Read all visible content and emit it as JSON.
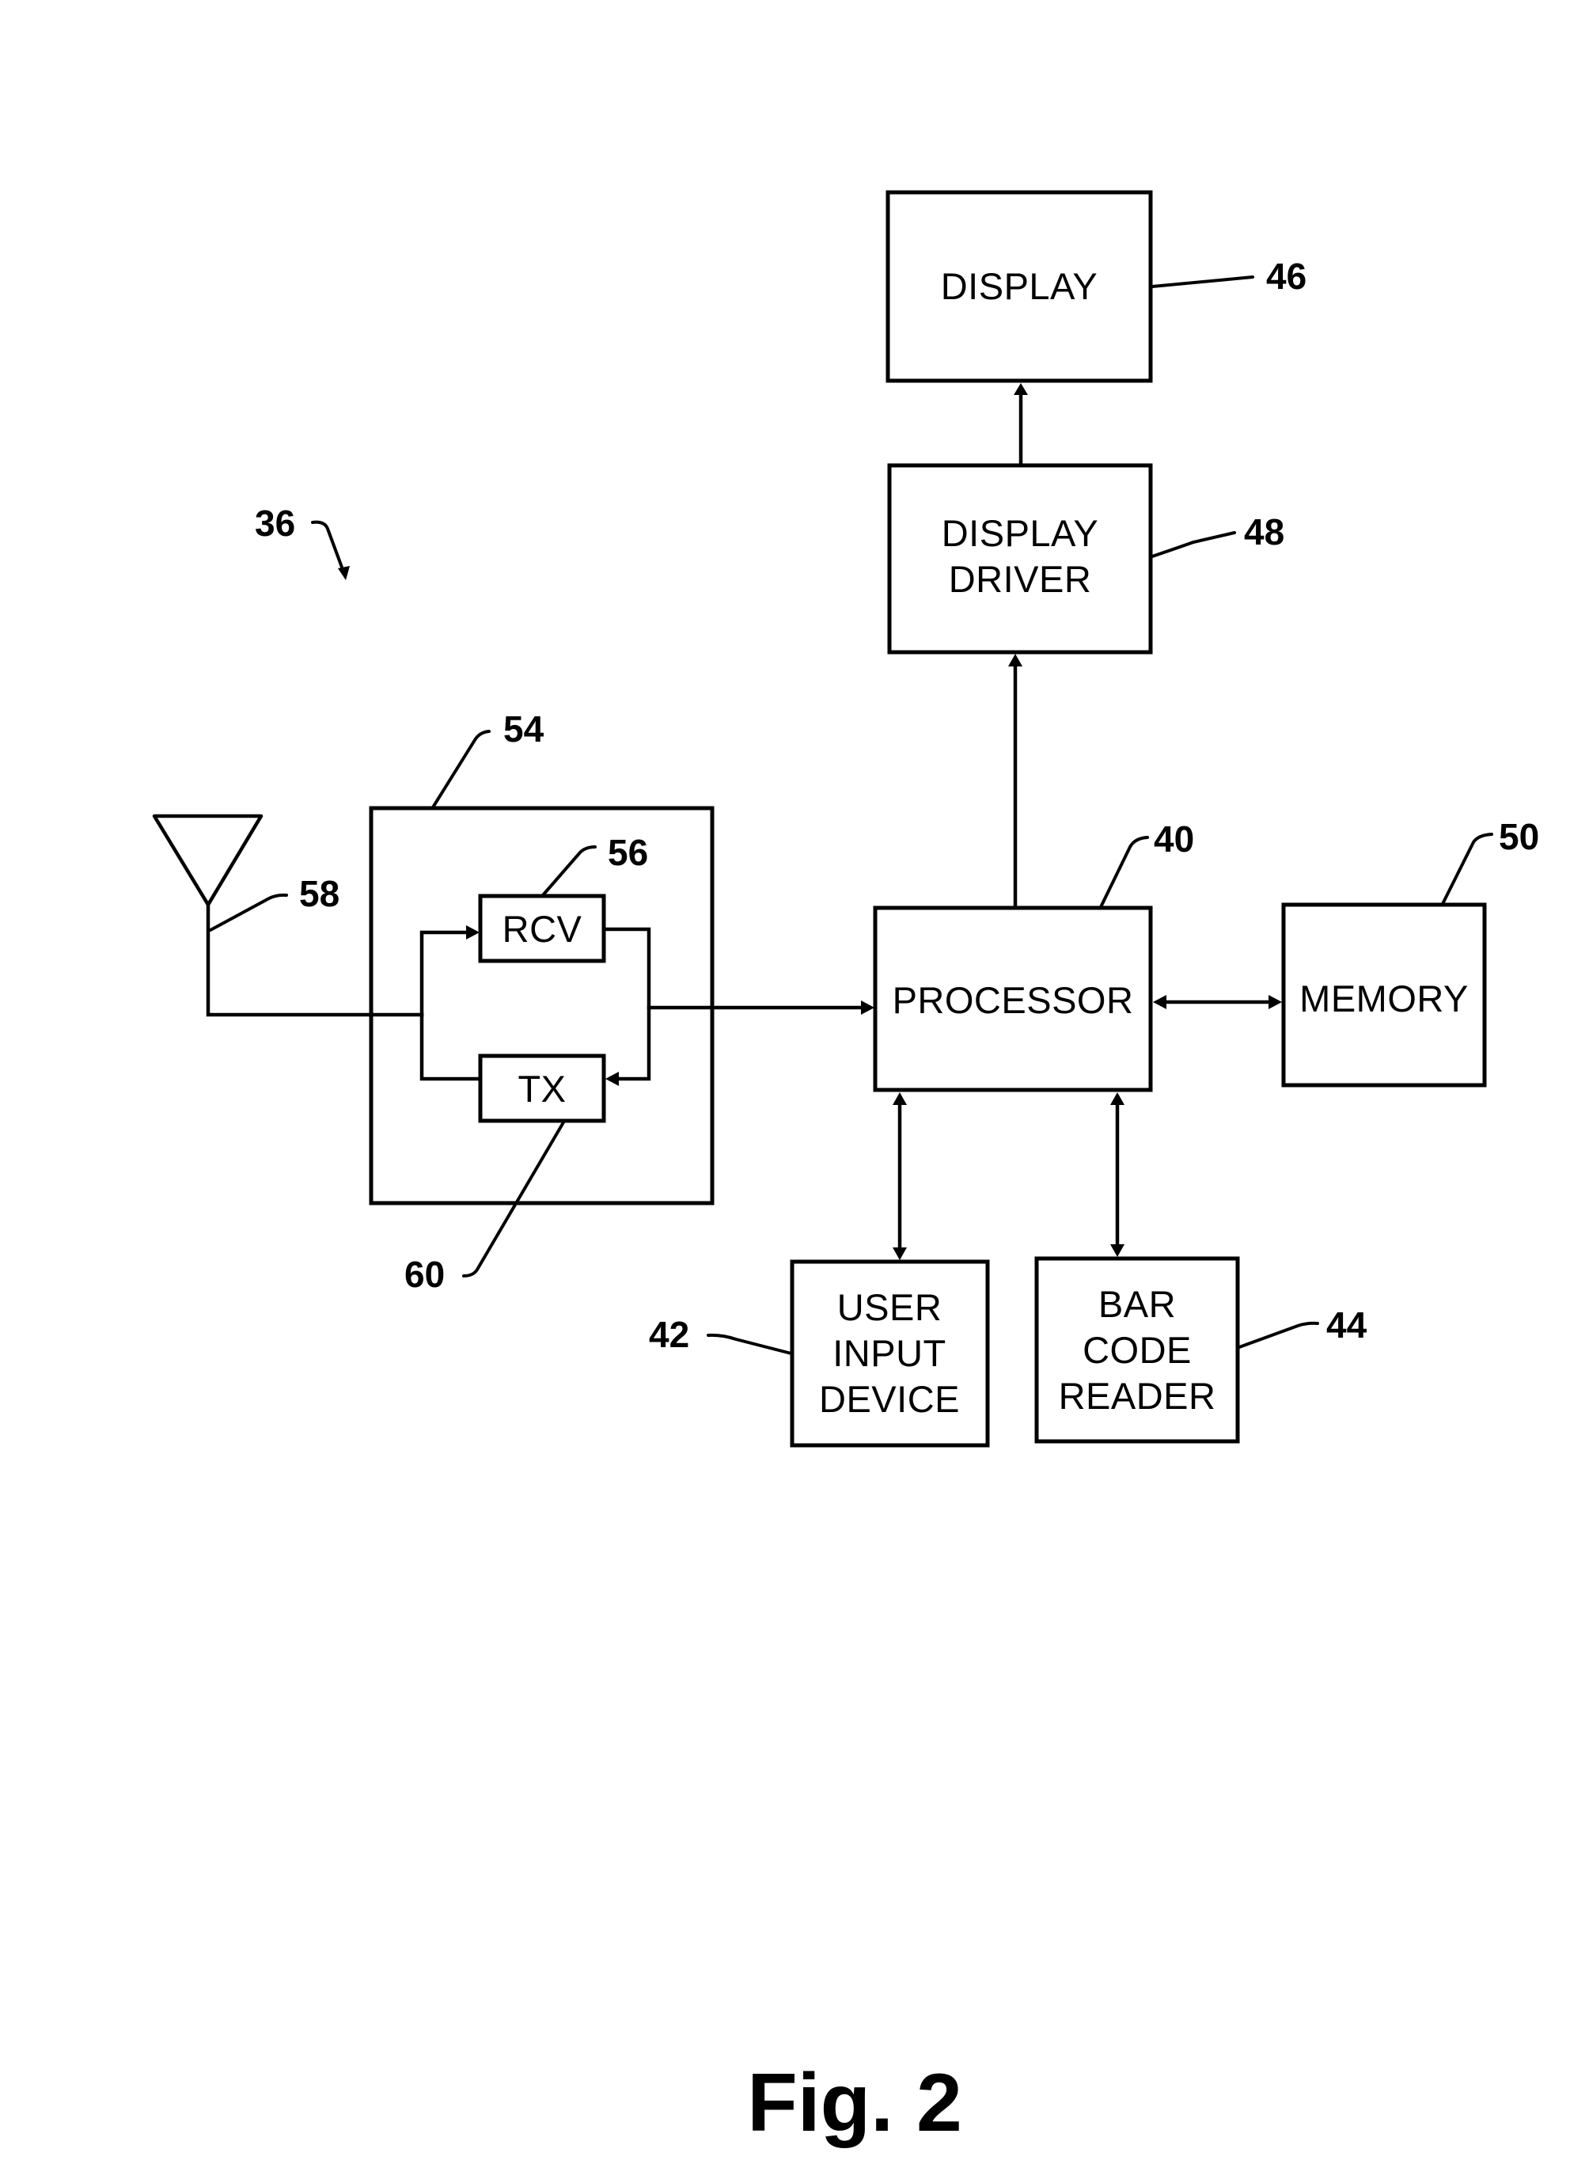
{
  "figure": {
    "caption": "Fig. 2",
    "reference_numeral": "36"
  },
  "blocks": {
    "display": {
      "lines": [
        "DISPLAY"
      ],
      "ref": "46"
    },
    "display_driver": {
      "lines": [
        "DISPLAY",
        "DRIVER"
      ],
      "ref": "48"
    },
    "processor": {
      "lines": [
        "PROCESSOR"
      ],
      "ref": "40"
    },
    "memory": {
      "lines": [
        "MEMORY"
      ],
      "ref": "50"
    },
    "user_input_device": {
      "lines": [
        "USER",
        "INPUT",
        "DEVICE"
      ],
      "ref": "42"
    },
    "bar_code_reader": {
      "lines": [
        "BAR",
        "CODE",
        "READER"
      ],
      "ref": "44"
    },
    "transceiver": {
      "lines": [],
      "ref": "54"
    },
    "receiver": {
      "lines": [
        "RCV"
      ],
      "ref": "56"
    },
    "transmitter": {
      "lines": [
        "TX"
      ],
      "ref": "60"
    },
    "antenna": {
      "lines": [],
      "ref": "58"
    }
  },
  "connections": [
    {
      "from": "display_driver",
      "to": "display",
      "direction": "one-way"
    },
    {
      "from": "processor",
      "to": "display_driver",
      "direction": "one-way"
    },
    {
      "from": "processor",
      "to": "memory",
      "direction": "two-way"
    },
    {
      "from": "processor",
      "to": "user_input_device",
      "direction": "two-way"
    },
    {
      "from": "processor",
      "to": "bar_code_reader",
      "direction": "two-way"
    },
    {
      "from": "transceiver",
      "to": "processor",
      "direction": "one-way"
    },
    {
      "from": "antenna",
      "to": "receiver",
      "direction": "one-way"
    },
    {
      "from": "transmitter",
      "to": "antenna",
      "direction": "one-way"
    },
    {
      "from": "receiver",
      "to": "transmitter",
      "direction": "one-way"
    }
  ]
}
